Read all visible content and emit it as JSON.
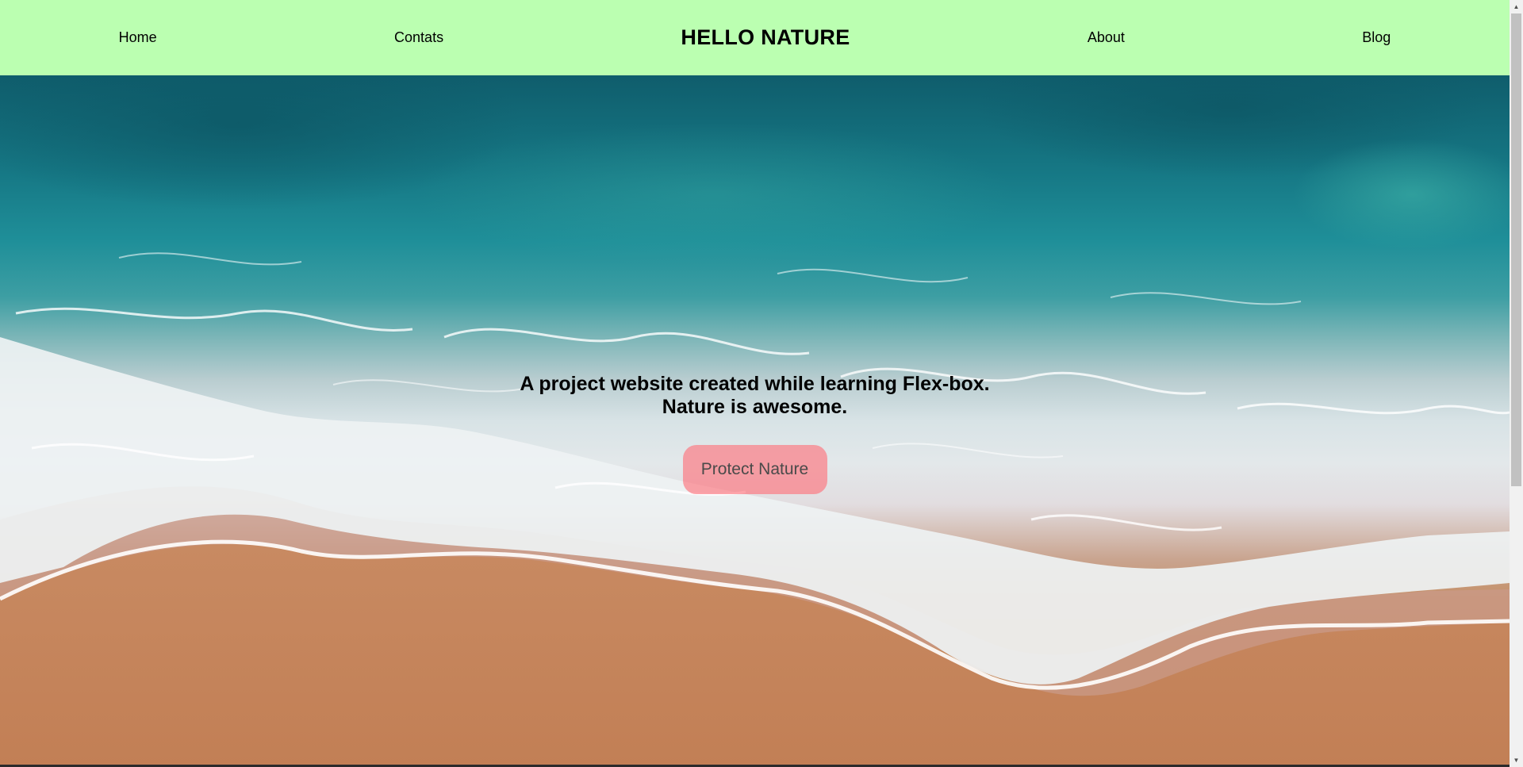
{
  "nav": {
    "home": "Home",
    "contacts": "Contats",
    "brand": "HELLO NATURE",
    "about": "About",
    "blog": "Blog"
  },
  "hero": {
    "line1": "A project website created while learning Flex-box.",
    "line2": "Nature is awesome.",
    "button": "Protect Nature",
    "image": "ocean-waves-beach-aerial"
  },
  "colors": {
    "nav_bg": "#bbffb1",
    "button_bg": "#ff6e78",
    "ocean": "#167885",
    "foam": "#e3e8ea",
    "sand": "#c48658"
  }
}
